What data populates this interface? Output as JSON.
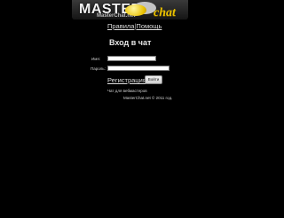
{
  "logo": {
    "master_text": "MASTER",
    "sub_text": "MasterChat.net",
    "chat_text": "chat"
  },
  "nav": {
    "rules_label": "Правила",
    "separator": "|",
    "help_label": "Помощь"
  },
  "login": {
    "title": "Вход в чат",
    "name_label": "Имя:",
    "name_value": "",
    "password_label": "Пароль:",
    "password_value": "",
    "register_label": "Регистрация",
    "submit_label": "Войти"
  },
  "footer": {
    "webmasters_label": "Чат для вебмастеров",
    "copyright": "MasterChat.net © 2011 год."
  },
  "colors": {
    "background": "#000000",
    "logo_accent": "#e8c000",
    "text": "#dddddd"
  }
}
